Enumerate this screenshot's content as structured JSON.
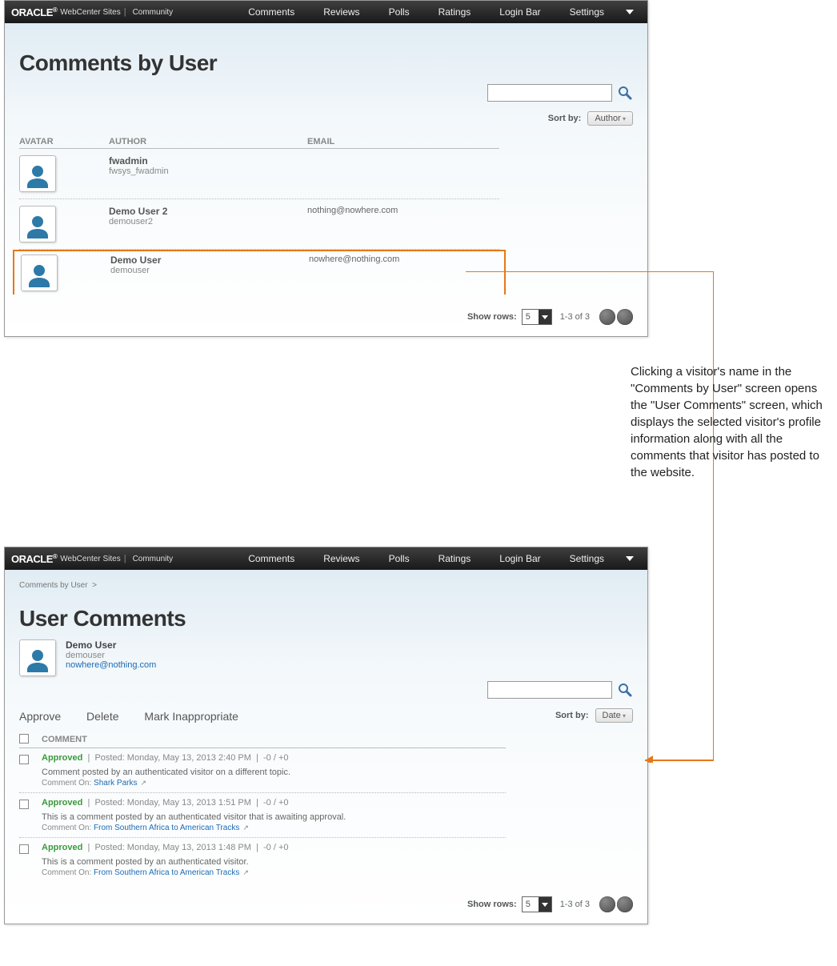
{
  "brand": {
    "name": "ORACLE",
    "reg": "®",
    "sub1": "WebCenter Sites",
    "sep": "|",
    "sub2": "Community"
  },
  "menu": {
    "comments": "Comments",
    "reviews": "Reviews",
    "polls": "Polls",
    "ratings": "Ratings",
    "loginbar": "Login Bar",
    "settings": "Settings"
  },
  "p1": {
    "title": "Comments by User",
    "sortby_label": "Sort by:",
    "sort_value": "Author",
    "cols": {
      "avatar": "AVATAR",
      "author": "AUTHOR",
      "email": "EMAIL"
    },
    "rows": [
      {
        "name": "fwadmin",
        "sub": "fwsys_fwadmin",
        "email": ""
      },
      {
        "name": "Demo User 2",
        "sub": "demouser2",
        "email": "nothing@nowhere.com"
      },
      {
        "name": "Demo User",
        "sub": "demouser",
        "email": "nowhere@nothing.com"
      }
    ],
    "pager": {
      "show_rows": "Show rows:",
      "value": "5",
      "range": "1-3 of 3"
    }
  },
  "callout": "Clicking a visitor's name in the \"Comments by User\" screen opens the \"User Comments\" screen, which displays the selected visitor's profile information along with all the comments that visitor has posted to the website.",
  "p2": {
    "breadcrumb": {
      "link": "Comments by User",
      "arrow": ">"
    },
    "title": "User Comments",
    "user": {
      "name": "Demo User",
      "sub": "demouser",
      "email": "nowhere@nothing.com"
    },
    "actions": {
      "approve": "Approve",
      "delete": "Delete",
      "mark": "Mark Inappropriate"
    },
    "sortby_label": "Sort by:",
    "sort_value": "Date",
    "col": "COMMENT",
    "comment_on_label": "Comment On:",
    "rows": [
      {
        "status": "Approved",
        "posted": "Posted: Monday, May 13, 2013 2:40 PM",
        "score": "-0 / +0",
        "text": "Comment posted by an authenticated visitor on a different topic.",
        "on": "Shark Parks"
      },
      {
        "status": "Approved",
        "posted": "Posted: Monday, May 13, 2013 1:51 PM",
        "score": "-0 / +0",
        "text": "This is a comment posted by an authenticated visitor that is awaiting approval.",
        "on": "From Southern Africa to American Tracks"
      },
      {
        "status": "Approved",
        "posted": "Posted: Monday, May 13, 2013 1:48 PM",
        "score": "-0 / +0",
        "text": "This is a comment posted by an authenticated visitor.",
        "on": "From Southern Africa to American Tracks"
      }
    ],
    "pager": {
      "show_rows": "Show rows:",
      "value": "5",
      "range": "1-3 of 3"
    }
  }
}
